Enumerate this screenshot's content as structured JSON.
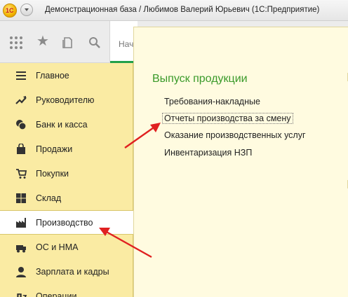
{
  "window": {
    "title": "Демонстрационная база / Любимов Валерий Юрьевич  (1С:Предприятие)",
    "logo_text": "1С"
  },
  "toolbar": {
    "tab_label": "Нач",
    "icons": [
      "apps-grid-icon",
      "star-icon",
      "history-icon",
      "search-icon"
    ]
  },
  "sidebar": {
    "items": [
      {
        "label": "Главное",
        "icon": "menu-lines-icon"
      },
      {
        "label": "Руководителю",
        "icon": "trend-icon"
      },
      {
        "label": "Банк и касса",
        "icon": "coins-icon"
      },
      {
        "label": "Продажи",
        "icon": "bag-icon"
      },
      {
        "label": "Покупки",
        "icon": "cart-icon"
      },
      {
        "label": "Склад",
        "icon": "warehouse-icon"
      },
      {
        "label": "Производство",
        "icon": "factory-icon",
        "active": true
      },
      {
        "label": "ОС и НМА",
        "icon": "assets-icon"
      },
      {
        "label": "Зарплата и кадры",
        "icon": "person-icon"
      },
      {
        "label": "Операции",
        "icon": "operations-icon"
      }
    ]
  },
  "panel": {
    "section_title": "Выпуск продукции",
    "links": [
      "Требования-накладные",
      "Отчеты производства за смену",
      "Оказание производственных услуг",
      "Инвентаризация НЗП"
    ]
  },
  "colors": {
    "sidebar_bg": "#faeba3",
    "panel_bg": "#fffbe0",
    "section_title": "#3a9a2a",
    "arrow": "#e02020",
    "tab_underline": "#22a04a"
  }
}
